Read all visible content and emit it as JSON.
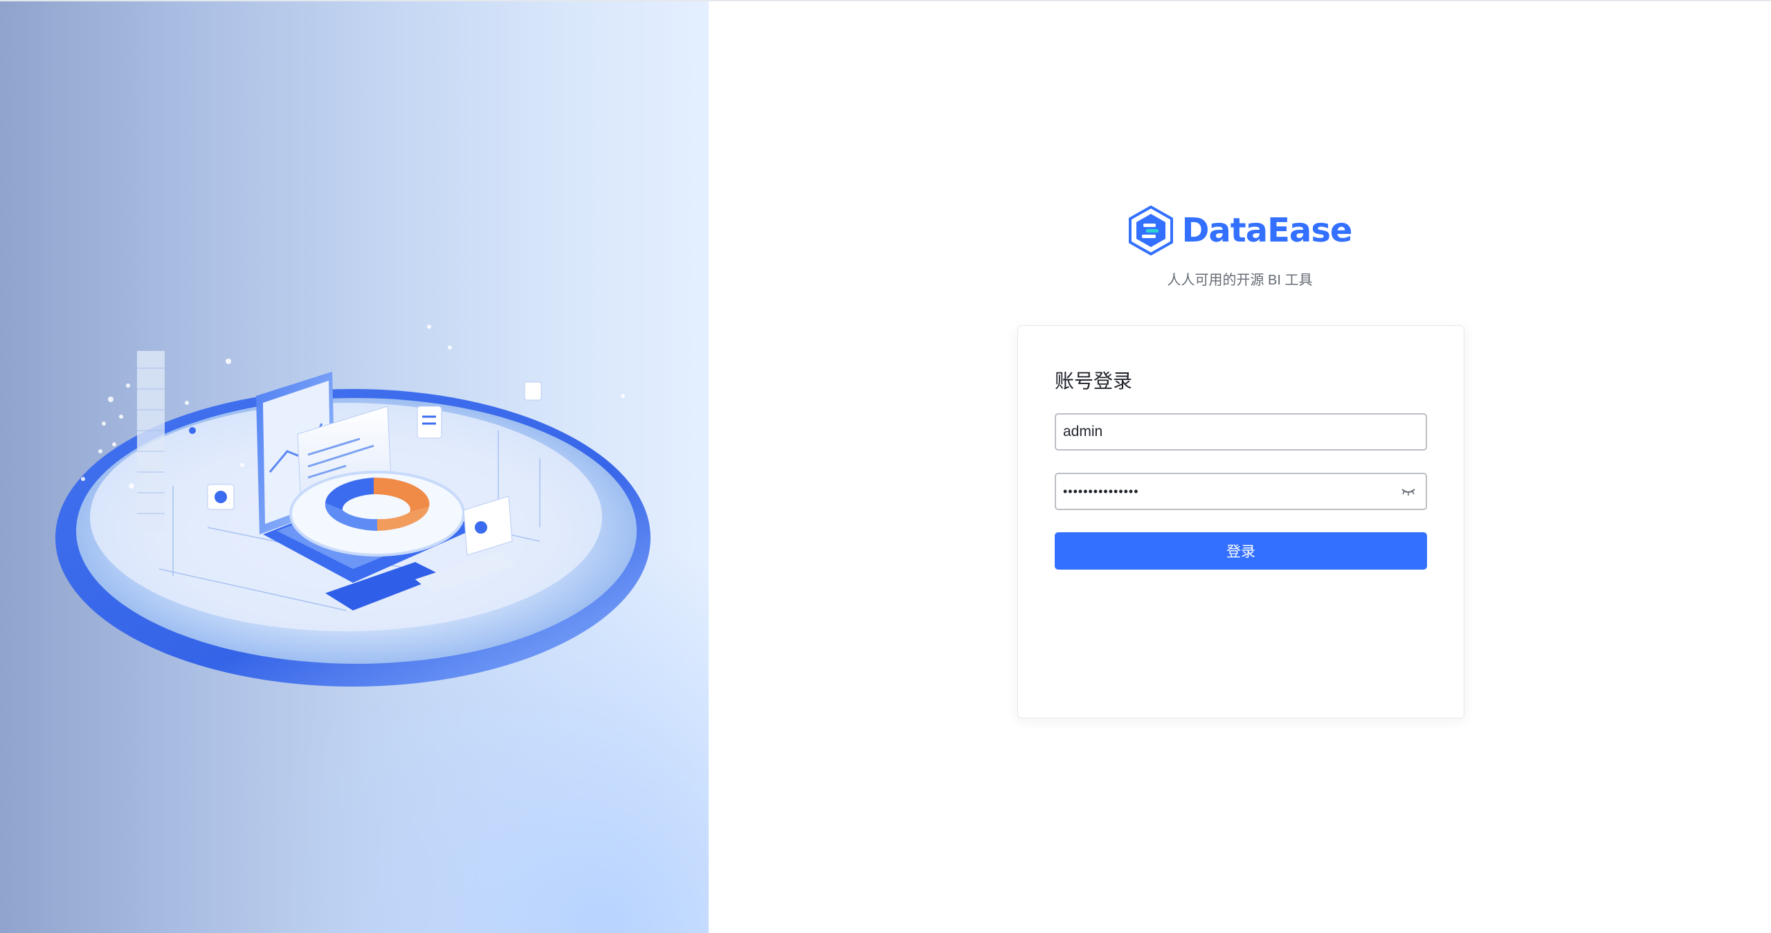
{
  "brand": {
    "name": "DataEase",
    "tagline": "人人可用的开源 BI 工具",
    "color": "#3370ff"
  },
  "hero": {
    "illustration": "isometric-data-dashboard-illustration"
  },
  "login": {
    "title": "账号登录",
    "username_value": "admin",
    "password_masked": "•••••••••••••••",
    "password_toggle_icon": "eye-closed-icon",
    "submit_label": "登录"
  },
  "colors": {
    "primary": "#3370ff",
    "border": "#bbbfc4",
    "text": "#1f2329",
    "muted": "#646a73"
  }
}
